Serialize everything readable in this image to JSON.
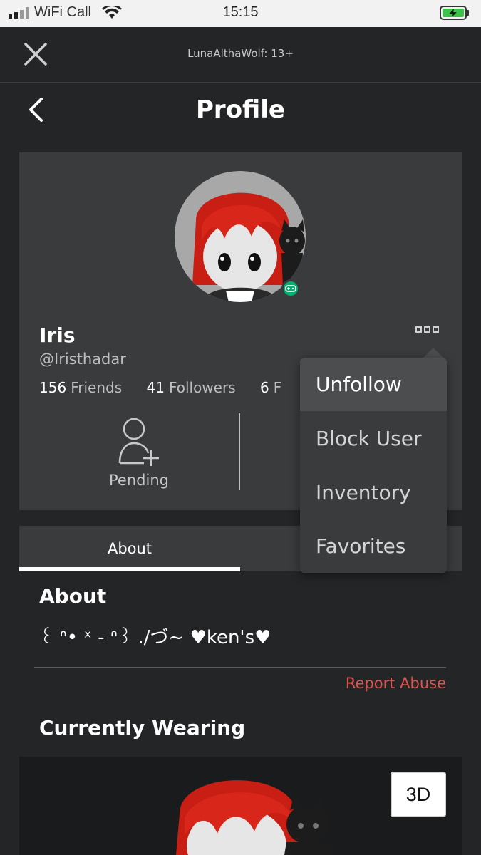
{
  "status_bar": {
    "carrier": "WiFi Call",
    "time": "15:15"
  },
  "webview": {
    "account_label": "LunaAlthaWolf: 13+"
  },
  "nav": {
    "title": "Profile"
  },
  "profile": {
    "display_name": "Iris",
    "username": "@Iristhadar",
    "stats": [
      {
        "count": "156",
        "label": "Friends"
      },
      {
        "count": "41",
        "label": "Followers"
      },
      {
        "count": "6",
        "label": "F"
      }
    ],
    "friend_action_label": "Pending",
    "online_status_color": "#00b06f"
  },
  "tabs": {
    "active_label": "About"
  },
  "about": {
    "title": "About",
    "text": "꒰ ᐢ• ˣ - ᐢ꒱ ./づ~ ♥ken's♥",
    "report_label": "Report Abuse"
  },
  "wearing": {
    "title": "Currently Wearing",
    "view_3d_label": "3D"
  },
  "menu": {
    "items": [
      "Unfollow",
      "Block User",
      "Inventory",
      "Favorites"
    ],
    "highlighted": "Unfollow"
  },
  "colors": {
    "background": "#232527",
    "card": "#393b3d",
    "report_red": "#e2514c",
    "online_green": "#00b06f"
  }
}
